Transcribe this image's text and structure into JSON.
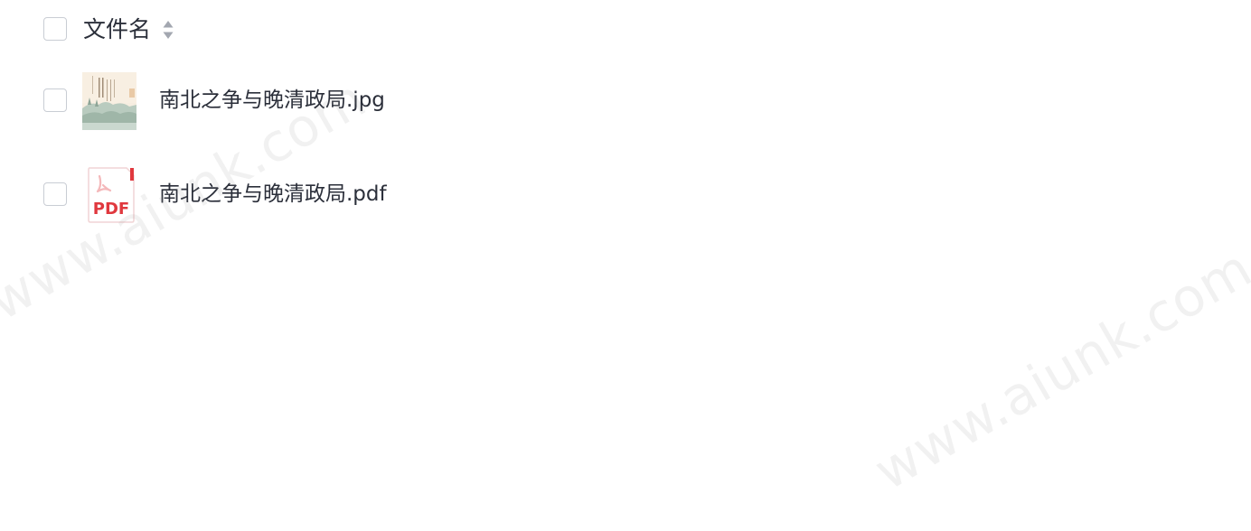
{
  "header": {
    "column_label": "文件名",
    "sort_icon": "sort-icon"
  },
  "files": [
    {
      "name": "南北之争与晚清政局.jpg",
      "icon": "jpg-thumbnail"
    },
    {
      "name": "南北之争与晚清政局.pdf",
      "icon": "pdf-icon",
      "icon_text": "PDF"
    }
  ],
  "watermark": {
    "text": "www.aiunk.com"
  },
  "colors": {
    "text": "#2b2f3a",
    "checkbox_border": "#c9cdd4",
    "pdf_red": "#e0383e",
    "watermark": "#969696"
  }
}
